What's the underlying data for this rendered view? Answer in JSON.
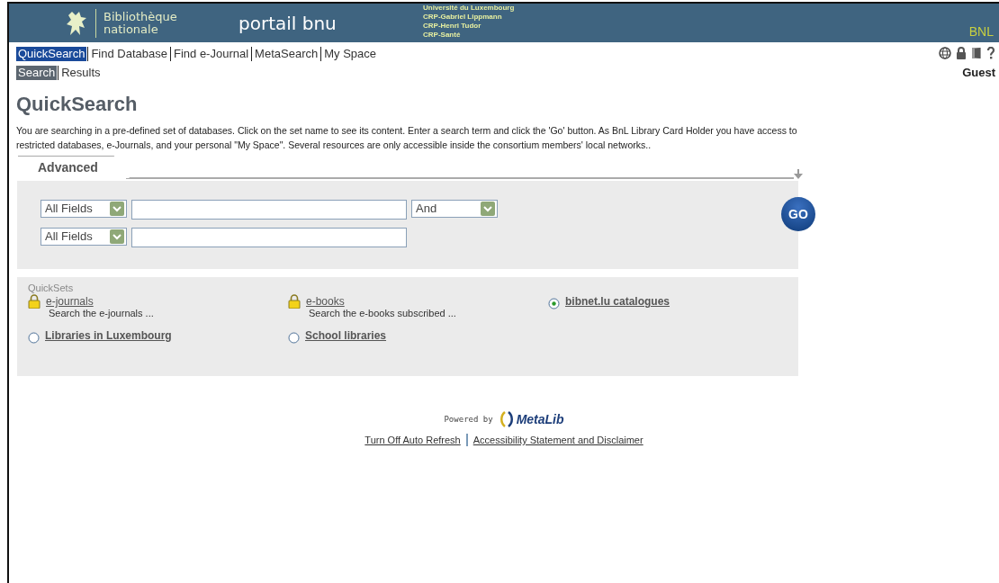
{
  "header": {
    "logo_text": "Bibliothèque nationale",
    "portal_title": "portail bnu",
    "partners": [
      "Université du Luxembourg",
      "CRP-Gabriel Lippmann",
      "CRP-Henri Tudor",
      "CRP-Santé"
    ],
    "institution": "BNL"
  },
  "nav": [
    {
      "label": "QuickSearch",
      "selected": true
    },
    {
      "label": "Find Database",
      "selected": false
    },
    {
      "label": "Find e-Journal",
      "selected": false
    },
    {
      "label": "MetaSearch",
      "selected": false
    },
    {
      "label": "My Space",
      "selected": false
    }
  ],
  "subnav": [
    {
      "label": "Search",
      "selected": true
    },
    {
      "label": "Results",
      "selected": false
    }
  ],
  "user": "Guest",
  "page_title": "QuickSearch",
  "intro": "You are searching in a pre-defined set of databases. Click on the set name to see its content. Enter a search term and click the 'Go' button. As BnL Library Card Holder you have access to restricted databases, e-Journals, and your personal \"My Space\". Several resources are only accessible inside the consortium members' local networks..",
  "search_tab": "Advanced",
  "search_rows": [
    {
      "field": "All Fields",
      "operator": "And"
    },
    {
      "field": "All Fields"
    }
  ],
  "go_button": "GO",
  "quicksets": {
    "title": "QuickSets",
    "items": [
      {
        "kind": "locked",
        "label": "e-journals",
        "description": "Search the e-journals ..."
      },
      {
        "kind": "locked",
        "label": "e-books",
        "description": "Search the e-books subscribed ..."
      },
      {
        "kind": "radio",
        "label": "bibnet.lu catalogues",
        "selected": true
      },
      {
        "kind": "radio",
        "label": "Libraries in Luxembourg",
        "selected": false
      },
      {
        "kind": "radio",
        "label": "School libraries",
        "selected": false
      }
    ]
  },
  "footer": {
    "powered_by": "Powered by",
    "brand": "MetaLib",
    "links": [
      "Turn Off Auto Refresh",
      "Accessibility Statement and Disclaimer"
    ]
  }
}
